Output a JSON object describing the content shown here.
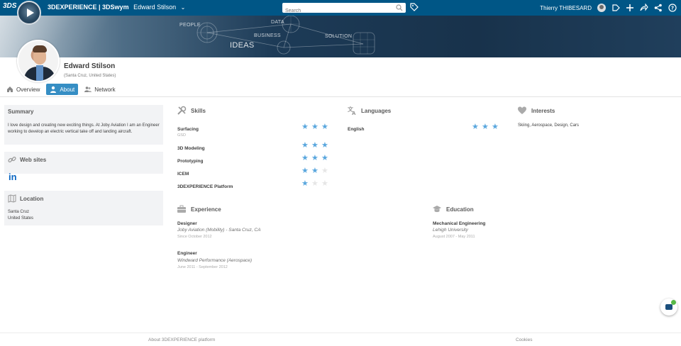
{
  "topbar": {
    "ds_logo": "3DS",
    "brand_strong": "3DEXPERIENCE",
    "brand_app": " | 3DSwym",
    "brand_user": "Edward Stilson",
    "search_placeholder": "Search",
    "current_user": "Thierry THIBESARD",
    "color": "#005686"
  },
  "banner": {
    "words": [
      "PEOPLE",
      "DATA",
      "BUSINESS",
      "SOLUTION",
      "IDEAS"
    ]
  },
  "profile": {
    "name": "Edward Stilson",
    "location": "(Santa Cruz, United States)"
  },
  "tabs": [
    {
      "label": "Overview",
      "icon": "home-icon",
      "active": false
    },
    {
      "label": "About",
      "icon": "person-icon",
      "active": true
    },
    {
      "label": "Network",
      "icon": "people-icon",
      "active": false
    }
  ],
  "summary": {
    "title": "Summary",
    "text": "I love design and creating new exciting things. At Joby Aviation I am an Engineer working to develop an electric vertical take off and landing aircraft."
  },
  "websites": {
    "title": "Web sites",
    "links": [
      "in"
    ]
  },
  "location_card": {
    "title": "Location",
    "city": "Santa Cruz",
    "country": "United States"
  },
  "skills": {
    "title": "Skills",
    "items": [
      {
        "name": "Surfacing",
        "sub": "GSD",
        "rating": 3
      },
      {
        "name": "3D Modeling",
        "sub": "",
        "rating": 3
      },
      {
        "name": "Prototyping",
        "sub": "",
        "rating": 3
      },
      {
        "name": "ICEM",
        "sub": "",
        "rating": 2
      },
      {
        "name": "3DEXPERIENCE Platform",
        "sub": "",
        "rating": 1
      }
    ],
    "max_rating": 3
  },
  "languages": {
    "title": "Languages",
    "items": [
      {
        "name": "English",
        "rating": 3
      }
    ]
  },
  "interests": {
    "title": "Interests",
    "text": "Skiing, Aerospace, Design, Cars"
  },
  "experience": {
    "title": "Experience",
    "items": [
      {
        "title": "Designer",
        "org": "Joby Aviation (Mobility) - Santa Cruz, CA",
        "date": "Since October 2012"
      },
      {
        "title": "Engineer",
        "org": "Windward Performance (Aerospace)",
        "date": "June 2011 - September 2012"
      }
    ]
  },
  "education": {
    "title": "Education",
    "items": [
      {
        "title": "Mechanical Engineering",
        "org": "Lehigh University",
        "date": "August 2007 - May 2011"
      }
    ]
  },
  "footer": {
    "about": "About 3DEXPERIENCE platform",
    "cookies": "Cookies"
  },
  "colors": {
    "accent": "#368ec4",
    "star": "#5aa7de",
    "star_off": "#e6e6e6"
  }
}
